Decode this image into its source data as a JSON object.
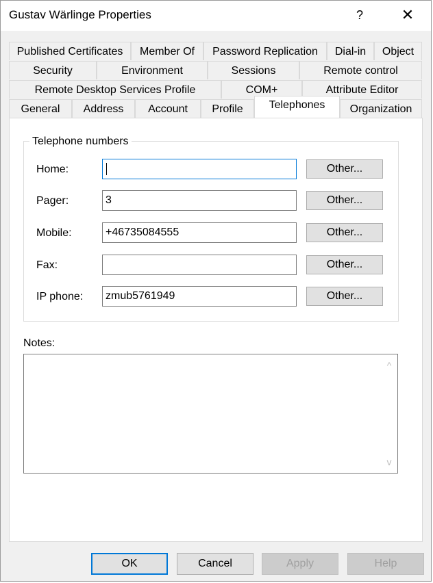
{
  "window": {
    "title": "Gustav Wärlinge Properties",
    "help_label": "?",
    "close_label": "✕"
  },
  "tabs": {
    "row1": [
      "Published Certificates",
      "Member Of",
      "Password Replication",
      "Dial-in",
      "Object"
    ],
    "row2": [
      "Security",
      "Environment",
      "Sessions",
      "Remote control"
    ],
    "row3": [
      "Remote Desktop Services Profile",
      "COM+",
      "Attribute Editor"
    ],
    "row4": [
      "General",
      "Address",
      "Account",
      "Profile",
      "Telephones",
      "Organization"
    ],
    "active": "Telephones"
  },
  "telephones": {
    "group_title": "Telephone numbers",
    "rows": [
      {
        "label": "Home:",
        "value": "",
        "button": "Other..."
      },
      {
        "label": "Pager:",
        "value": "3",
        "button": "Other..."
      },
      {
        "label": "Mobile:",
        "value": "+46735084555",
        "button": "Other..."
      },
      {
        "label": "Fax:",
        "value": "",
        "button": "Other..."
      },
      {
        "label": "IP phone:",
        "value": "zmub5761949",
        "button": "Other..."
      }
    ]
  },
  "notes": {
    "label": "Notes:",
    "value": "",
    "scroll_up": "^",
    "scroll_down": "v"
  },
  "footer": {
    "ok": "OK",
    "cancel": "Cancel",
    "apply": "Apply",
    "help": "Help"
  },
  "colors": {
    "accent": "#0078d7",
    "window_bg": "#f0f0f0",
    "panel_bg": "#ffffff"
  }
}
